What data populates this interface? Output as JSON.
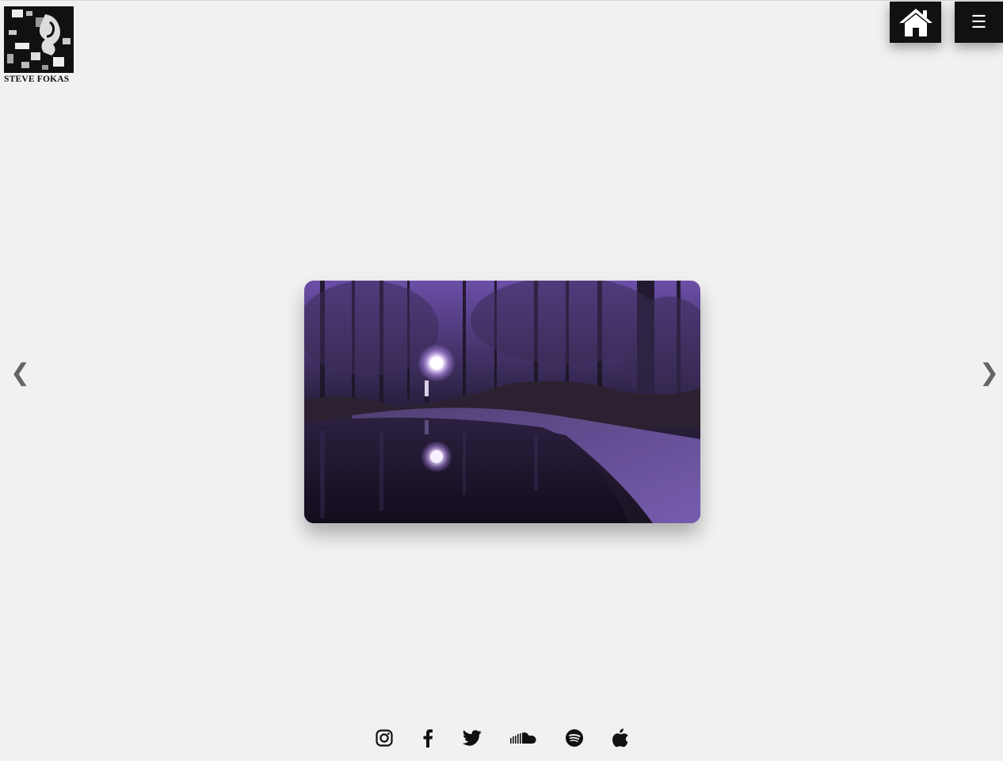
{
  "brand": {
    "logo_text": "STEVE FOKAS"
  },
  "header": {
    "home_icon": "home-icon",
    "menu_icon": "hamburger-menu-icon",
    "menu_glyph": "☰"
  },
  "slider": {
    "prev_glyph": "❮",
    "next_glyph": "❯",
    "image_description_icon": "forest-night-photo"
  },
  "social": {
    "icons": [
      "instagram-icon",
      "facebook-icon",
      "twitter-icon",
      "soundcloud-icon",
      "spotify-icon",
      "apple-icon"
    ]
  },
  "colors": {
    "background": "#f1f1f1",
    "button_bg": "#111111",
    "photo_tint": "#7a56c8"
  }
}
